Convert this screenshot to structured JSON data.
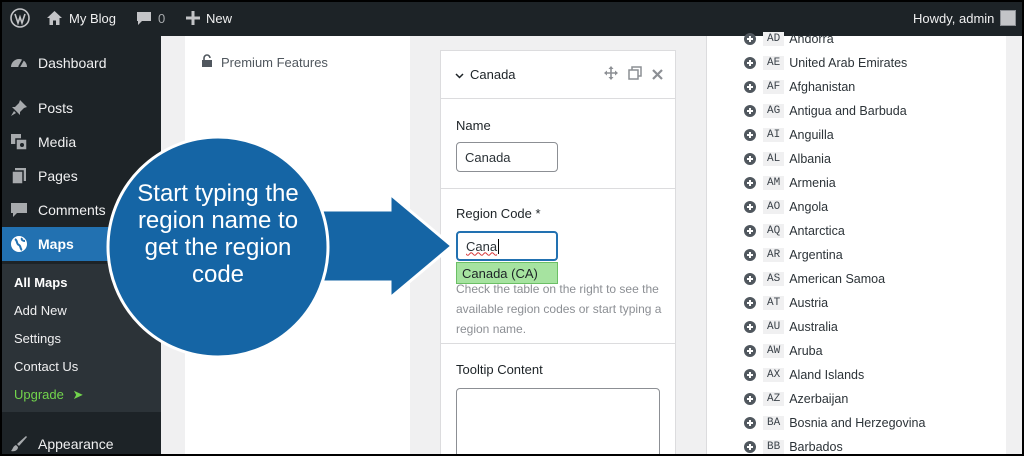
{
  "adminbar": {
    "site_name": "My Blog",
    "comments_count": "0",
    "new_label": "New",
    "howdy": "Howdy, admin"
  },
  "sidebar": {
    "items": [
      {
        "label": "Dashboard",
        "icon": "dashboard-icon"
      },
      {
        "label": "Posts",
        "icon": "pin-icon"
      },
      {
        "label": "Media",
        "icon": "media-icon"
      },
      {
        "label": "Pages",
        "icon": "pages-icon"
      },
      {
        "label": "Comments",
        "icon": "comment-icon"
      },
      {
        "label": "Maps",
        "icon": "globe-icon"
      },
      {
        "label": "Appearance",
        "icon": "brush-icon"
      }
    ],
    "submenu": [
      "All Maps",
      "Add New",
      "Settings",
      "Contact Us",
      "Upgrade"
    ],
    "current_color": "#2271b1",
    "upgrade_color": "#72d44c"
  },
  "left_panel": {
    "premium_label": "Premium Features"
  },
  "region_card": {
    "title": "Canada",
    "name_label": "Name",
    "name_value": "Canada",
    "region_code_label": "Region Code *",
    "region_code_value": "Cana",
    "suggestion": "Canada (CA)",
    "help_text": "Check the table on the right to see the available region codes or start typing a region name.",
    "tooltip_label": "Tooltip Content"
  },
  "regions": [
    {
      "code": "AD",
      "name": "Andorra"
    },
    {
      "code": "AE",
      "name": "United Arab Emirates"
    },
    {
      "code": "AF",
      "name": "Afghanistan"
    },
    {
      "code": "AG",
      "name": "Antigua and Barbuda"
    },
    {
      "code": "AI",
      "name": "Anguilla"
    },
    {
      "code": "AL",
      "name": "Albania"
    },
    {
      "code": "AM",
      "name": "Armenia"
    },
    {
      "code": "AO",
      "name": "Angola"
    },
    {
      "code": "AQ",
      "name": "Antarctica"
    },
    {
      "code": "AR",
      "name": "Argentina"
    },
    {
      "code": "AS",
      "name": "American Samoa"
    },
    {
      "code": "AT",
      "name": "Austria"
    },
    {
      "code": "AU",
      "name": "Australia"
    },
    {
      "code": "AW",
      "name": "Aruba"
    },
    {
      "code": "AX",
      "name": "Aland Islands"
    },
    {
      "code": "AZ",
      "name": "Azerbaijan"
    },
    {
      "code": "BA",
      "name": "Bosnia and Herzegovina"
    },
    {
      "code": "BB",
      "name": "Barbados"
    }
  ],
  "callout": {
    "text": "Start typing the region name to get the region code",
    "color": "#1565a5"
  }
}
